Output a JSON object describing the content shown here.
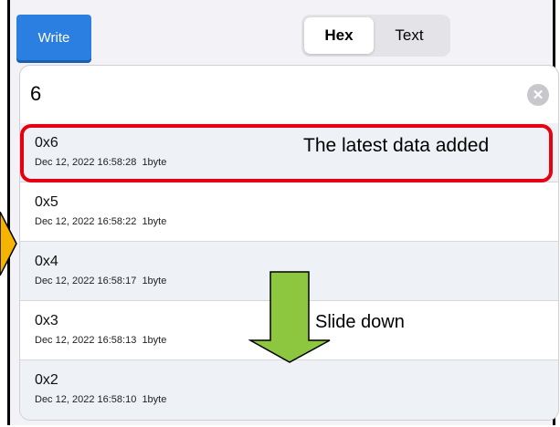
{
  "toolbar": {
    "write_label": "Write"
  },
  "segmented": {
    "hex_label": "Hex",
    "text_label": "Text",
    "selected": "Hex"
  },
  "input": {
    "value": "6"
  },
  "entries": [
    {
      "value": "0x6",
      "timestamp": "Dec 12, 2022 16:58:28",
      "size": "1byte"
    },
    {
      "value": "0x5",
      "timestamp": "Dec 12, 2022 16:58:22",
      "size": "1byte"
    },
    {
      "value": "0x4",
      "timestamp": "Dec 12, 2022 16:58:17",
      "size": "1byte"
    },
    {
      "value": "0x3",
      "timestamp": "Dec 12, 2022 16:58:13",
      "size": "1byte"
    },
    {
      "value": "0x2",
      "timestamp": "Dec 12, 2022 16:58:10",
      "size": "1byte"
    }
  ],
  "annotations": {
    "latest_label": "The latest data added",
    "slide_label": "Slide down",
    "highlight_color": "#e60012",
    "arrow_color": "#8dc63f"
  },
  "colors": {
    "accent": "#2a7fe0",
    "side_arrow": "#f5b400"
  }
}
